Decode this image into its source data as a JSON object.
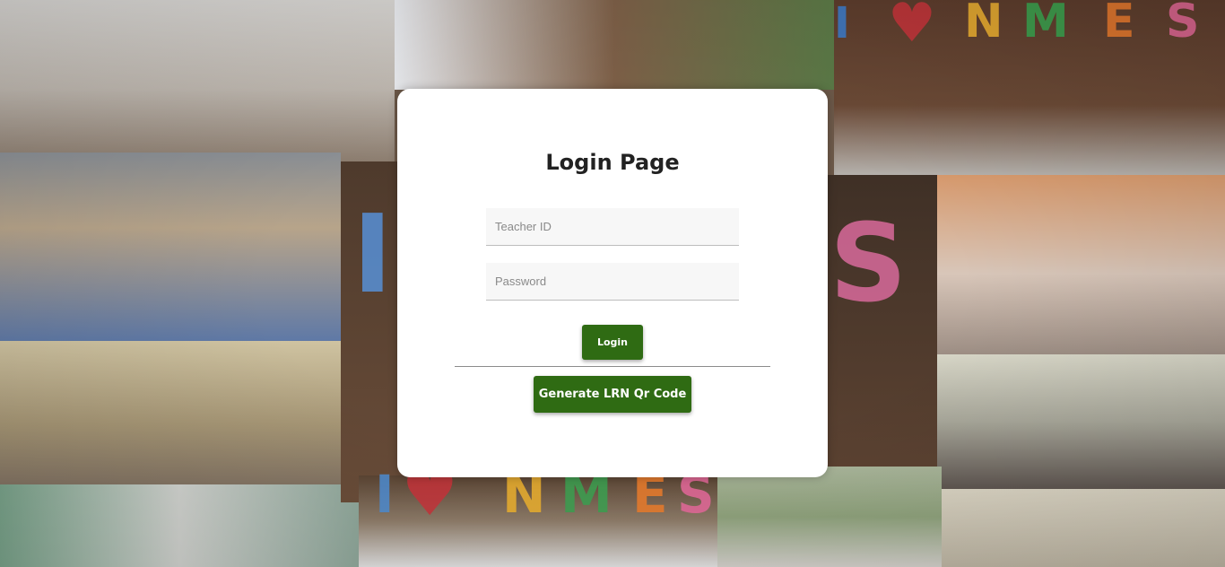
{
  "login": {
    "title": "Login Page",
    "teacher_id_placeholder": "Teacher ID",
    "password_placeholder": "Password",
    "login_label": "Login",
    "generate_label": "Generate LRN Qr Code"
  },
  "colors": {
    "button_green": "#2f6b13",
    "card_background": "#ffffff",
    "field_background": "#f7f7f7"
  }
}
